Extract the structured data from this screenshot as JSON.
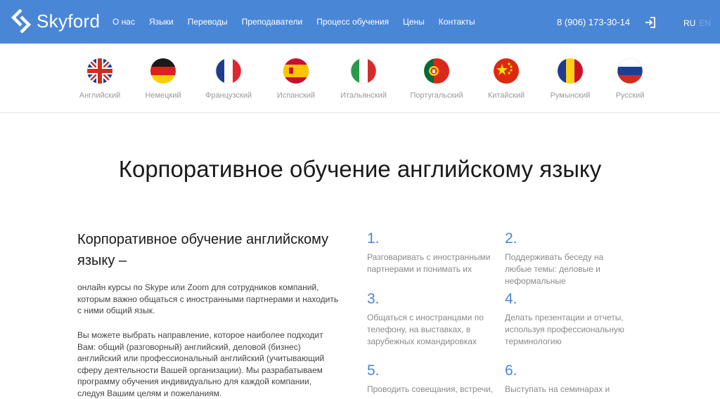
{
  "header": {
    "brand": "Skyford",
    "nav": [
      "О нас",
      "Языки",
      "Переводы",
      "Преподаватели",
      "Процесс обучения",
      "Цены",
      "Контакты"
    ],
    "phone": "8 (906) 173-30-14",
    "lang_ru": "RU",
    "lang_en": "EN",
    "bg_color": "#4a86d6"
  },
  "languages": [
    {
      "label": "Английский",
      "flag": "uk-flag-icon"
    },
    {
      "label": "Немецкий",
      "flag": "germany-flag-icon"
    },
    {
      "label": "Французский",
      "flag": "france-flag-icon"
    },
    {
      "label": "Испанский",
      "flag": "spain-flag-icon"
    },
    {
      "label": "Итальянский",
      "flag": "italy-flag-icon"
    },
    {
      "label": "Португальский",
      "flag": "portugal-flag-icon"
    },
    {
      "label": "Китайский",
      "flag": "china-flag-icon"
    },
    {
      "label": "Румынский",
      "flag": "romania-flag-icon"
    },
    {
      "label": "Русский",
      "flag": "russia-flag-icon"
    }
  ],
  "main": {
    "title": "Корпоративное обучение английскому языку",
    "subtitle": "Корпоративное обучение английскому языку –",
    "para1": "онлайн курсы по Skype или Zoom для сотрудников компаний, которым важно общаться с иностранными партнерами и находить с ними общий язык.",
    "para2": "Вы можете выбрать направление, которое наиболее подходит Вам: общий (разговорный) английский, деловой (бизнес) английский или профессиональный английский (учитывающий сферу деятельности Вашей организации). Мы разрабатываем программу обучения индивидуально для каждой компании, следуя Вашим целям и пожеланиям.",
    "features": [
      {
        "num": "1.",
        "text": "Разговаривать с иностранными партнерами и понимать их"
      },
      {
        "num": "2.",
        "text": "Поддерживать беседу на любые темы: деловые и неформальные"
      },
      {
        "num": "3.",
        "text": "Общаться с иностранцами по телефону, на выставках, в зарубежных командировках"
      },
      {
        "num": "4.",
        "text": "Делать презентации и отчеты, используя профессиональную терминологию"
      },
      {
        "num": "5.",
        "text": "Проводить совещания, встречи,"
      },
      {
        "num": "6.",
        "text": "Выступать на семинарах и"
      }
    ]
  }
}
